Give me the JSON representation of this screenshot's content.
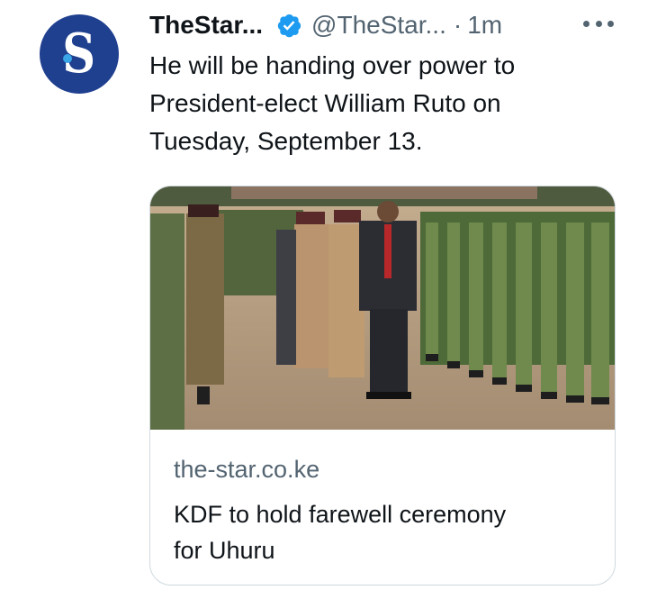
{
  "tweet": {
    "display_name": "TheStar...",
    "handle": "@TheStar...",
    "separator": "·",
    "time": "1m",
    "text_lines": [
      "He will be handing over power to",
      "President-elect William Ruto on",
      "Tuesday, September 13."
    ],
    "avatar_letter": "S",
    "icons": {
      "verified": "verified-badge-icon",
      "more": "more-options-icon"
    },
    "colors": {
      "avatar_bg": "#1f3f8f",
      "verified": "#1d9bf0",
      "secondary_text": "#536471"
    }
  },
  "card": {
    "image_alt": "Military parade inspection with officers walking past soldiers in camouflage",
    "domain": "the-star.co.ke",
    "title_lines": [
      "KDF to hold farewell ceremony",
      "for Uhuru"
    ]
  }
}
